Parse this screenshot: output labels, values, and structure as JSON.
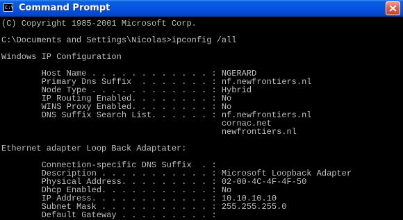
{
  "window": {
    "title": "Command Prompt",
    "icon_text": "C:\\"
  },
  "console": {
    "copyright": "(C) Copyright 1985-2001 Microsoft Corp.",
    "prompt": "C:\\Documents and Settings\\Nicolas>ipconfig /all",
    "section_ip_config": "Windows IP Configuration",
    "host_name": "        Host Name . . . . . . . . . . . . : NGERARD",
    "primary_dns_suffix": "        Primary Dns Suffix  . . . . . . . : nf.newfrontiers.nl",
    "node_type": "        Node Type . . . . . . . . . . . . : Hybrid",
    "ip_routing": "        IP Routing Enabled. . . . . . . . : No",
    "wins_proxy": "        WINS Proxy Enabled. . . . . . . . : No",
    "dns_suffix_search_1": "        DNS Suffix Search List. . . . . . : nf.newfrontiers.nl",
    "dns_suffix_search_2": "                                            cornac.net",
    "dns_suffix_search_3": "                                            newfrontiers.nl",
    "section_adapter": "Ethernet adapter Loop Back Adaptater:",
    "conn_dns_suffix": "        Connection-specific DNS Suffix  . :",
    "description": "        Description . . . . . . . . . . . : Microsoft Loopback Adapter",
    "physical_address": "        Physical Address. . . . . . . . . : 02-00-4C-4F-4F-50",
    "dhcp_enabled": "        Dhcp Enabled. . . . . . . . . . . : No",
    "ip_address": "        IP Address. . . . . . . . . . . . : 10.10.10.10",
    "subnet_mask": "        Subnet Mask . . . . . . . . . . . : 255.255.255.0",
    "default_gateway": "        Default Gateway . . . . . . . . . :"
  },
  "colors": {
    "titlebar": "#0554e3",
    "console_background": "#000000",
    "console_text": "#c0c0c0",
    "close_button": "#e0604a"
  },
  "icons": {
    "window_icon": "cmd-icon",
    "close": "close-icon"
  }
}
